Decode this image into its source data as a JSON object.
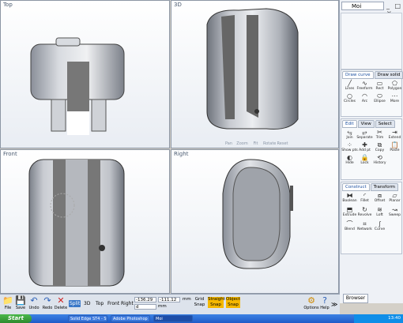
{
  "viewports": {
    "top": {
      "title": "Top"
    },
    "threed": {
      "title": "3D",
      "nav": [
        "Pan",
        "Zoom",
        "Fit",
        "Rotate",
        "Reset"
      ]
    },
    "front": {
      "title": "Front"
    },
    "right": {
      "title": "Right"
    }
  },
  "app": {
    "title": "Moi",
    "window_controls": "_ □ ×"
  },
  "draw_curve": {
    "tabs": [
      "Draw curve",
      "Draw solid"
    ],
    "tools": [
      {
        "label": "Lines",
        "icon": "lines-icon"
      },
      {
        "label": "Freeform",
        "icon": "freeform-icon"
      },
      {
        "label": "Rect",
        "icon": "rect-icon"
      },
      {
        "label": "Polygon",
        "icon": "polygon-icon"
      },
      {
        "label": "Circles",
        "icon": "circle-icon"
      },
      {
        "label": "Arc",
        "icon": "arc-icon"
      },
      {
        "label": "Ellipse",
        "icon": "ellipse-icon"
      },
      {
        "label": "More",
        "icon": "more-icon"
      }
    ]
  },
  "edit": {
    "tabs": [
      "Edit",
      "View",
      "Select"
    ],
    "tools": [
      {
        "label": "Join",
        "icon": "join-icon"
      },
      {
        "label": "Separate",
        "icon": "separate-icon"
      },
      {
        "label": "Trim",
        "icon": "trim-icon"
      },
      {
        "label": "Extend",
        "icon": "extend-icon"
      },
      {
        "label": "Show pts",
        "icon": "show-points-icon"
      },
      {
        "label": "Add pt",
        "icon": "add-point-icon"
      },
      {
        "label": "Copy",
        "icon": "copy-icon"
      },
      {
        "label": "Paste",
        "icon": "paste-icon"
      },
      {
        "label": "Hide",
        "icon": "hide-icon"
      },
      {
        "label": "Lock",
        "icon": "lock-icon"
      },
      {
        "label": "History",
        "icon": "history-icon"
      }
    ]
  },
  "construct": {
    "tabs": [
      "Construct",
      "Transform"
    ],
    "tools": [
      {
        "label": "Boolean",
        "icon": "boolean-icon"
      },
      {
        "label": "Fillet",
        "icon": "fillet-icon"
      },
      {
        "label": "Offset",
        "icon": "offset-icon"
      },
      {
        "label": "Planar",
        "icon": "planar-icon"
      },
      {
        "label": "Extrude",
        "icon": "extrude-icon"
      },
      {
        "label": "Revolve",
        "icon": "revolve-icon"
      },
      {
        "label": "Loft",
        "icon": "loft-icon"
      },
      {
        "label": "Sweep",
        "icon": "sweep-icon"
      },
      {
        "label": "Blend",
        "icon": "blend-icon"
      },
      {
        "label": "Network",
        "icon": "network-icon"
      },
      {
        "label": "Curve",
        "icon": "curve-icon"
      }
    ]
  },
  "toolbar": {
    "buttons": [
      {
        "label": "File",
        "icon": "folder-icon"
      },
      {
        "label": "Save",
        "icon": "save-icon"
      },
      {
        "label": "Undo",
        "icon": "undo-icon"
      },
      {
        "label": "Redo",
        "icon": "redo-icon"
      },
      {
        "label": "Delete",
        "icon": "delete-icon"
      }
    ],
    "views": [
      "Split",
      "3D",
      "Top",
      "Front",
      "Right"
    ],
    "active_view": "Split",
    "coord_x": "-136.29",
    "coord_y": "-111.12",
    "coord_d": "d",
    "unit": "mm",
    "grid_snap": "Grid Snap",
    "straight_snap": "Straight Snap",
    "object_snap": "Object Snap",
    "options": "Options",
    "help": "Help",
    "browser": "Browser"
  },
  "taskbar": {
    "start": "Start",
    "tasks": [
      "Solid Edge ST4 - Sync...",
      "Adobe Photoshop",
      "Moi"
    ],
    "time": "13:40"
  }
}
